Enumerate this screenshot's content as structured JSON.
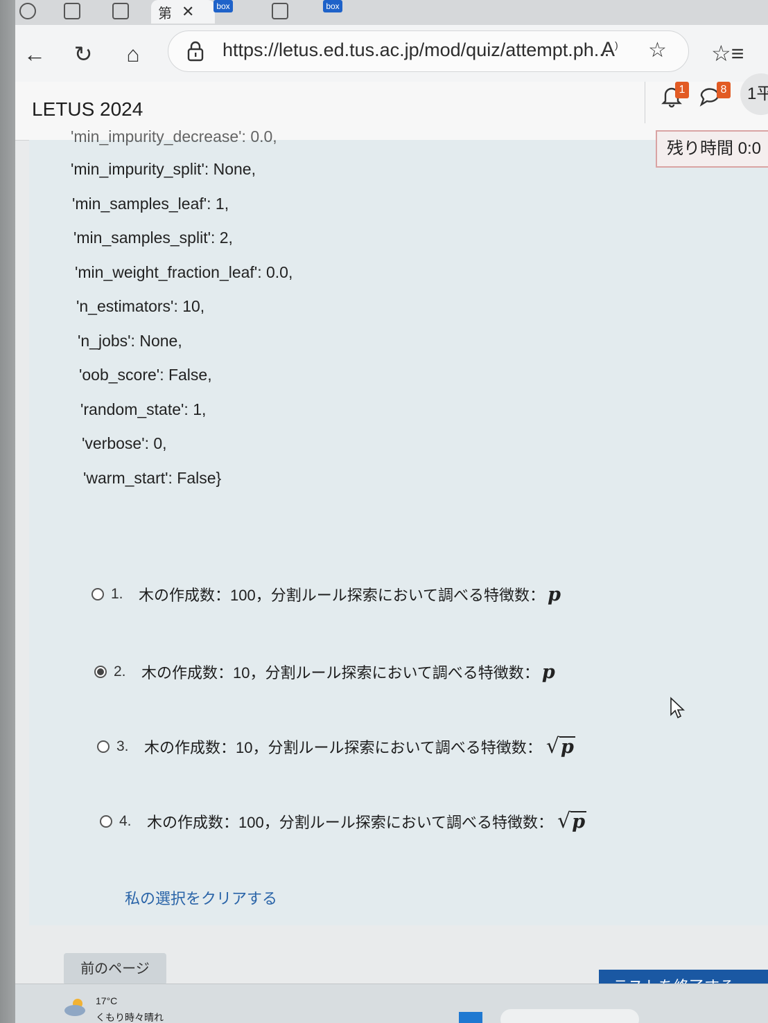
{
  "browser": {
    "active_tab": {
      "label": "第"
    },
    "box_label": "box",
    "url": "https://letus.ed.tus.ac.jp/mod/quiz/attempt.ph..."
  },
  "site": {
    "brand": "LETUS 2024",
    "notifications_count": "1",
    "messages_count": "8",
    "user_menu_label": "1平",
    "timer_label": "残り時間 0:0"
  },
  "question": {
    "cutoff_line": "'min_impurity_decrease': 0.0,",
    "params": [
      "'min_impurity_split': None,",
      "'min_samples_leaf': 1,",
      "'min_samples_split': 2,",
      "'min_weight_fraction_leaf': 0.0,",
      "'n_estimators': 10,",
      "'n_jobs': None,",
      "'oob_score': False,",
      "'random_state': 1,",
      "'verbose': 0,",
      "'warm_start': False}"
    ],
    "options": [
      {
        "num": "1.",
        "text": "木の作成数：100，分割ルール探索において調べる特徴数：",
        "math": "p",
        "sqrt": false,
        "selected": false
      },
      {
        "num": "2.",
        "text": "木の作成数：10，分割ルール探索において調べる特徴数：",
        "math": "p",
        "sqrt": false,
        "selected": true
      },
      {
        "num": "3.",
        "text": "木の作成数：10，分割ルール探索において調べる特徴数：",
        "math": "p",
        "sqrt": true,
        "selected": false
      },
      {
        "num": "4.",
        "text": "木の作成数：100，分割ルール探索において調べる特徴数：",
        "math": "p",
        "sqrt": true,
        "selected": false
      }
    ],
    "clear_label": "私の選択をクリアする"
  },
  "navigation": {
    "prev_label": "前のページ",
    "finish_label": "テストを終了する ..."
  },
  "taskbar": {
    "temperature": "17°C",
    "condition": "くもり時々晴れ"
  }
}
